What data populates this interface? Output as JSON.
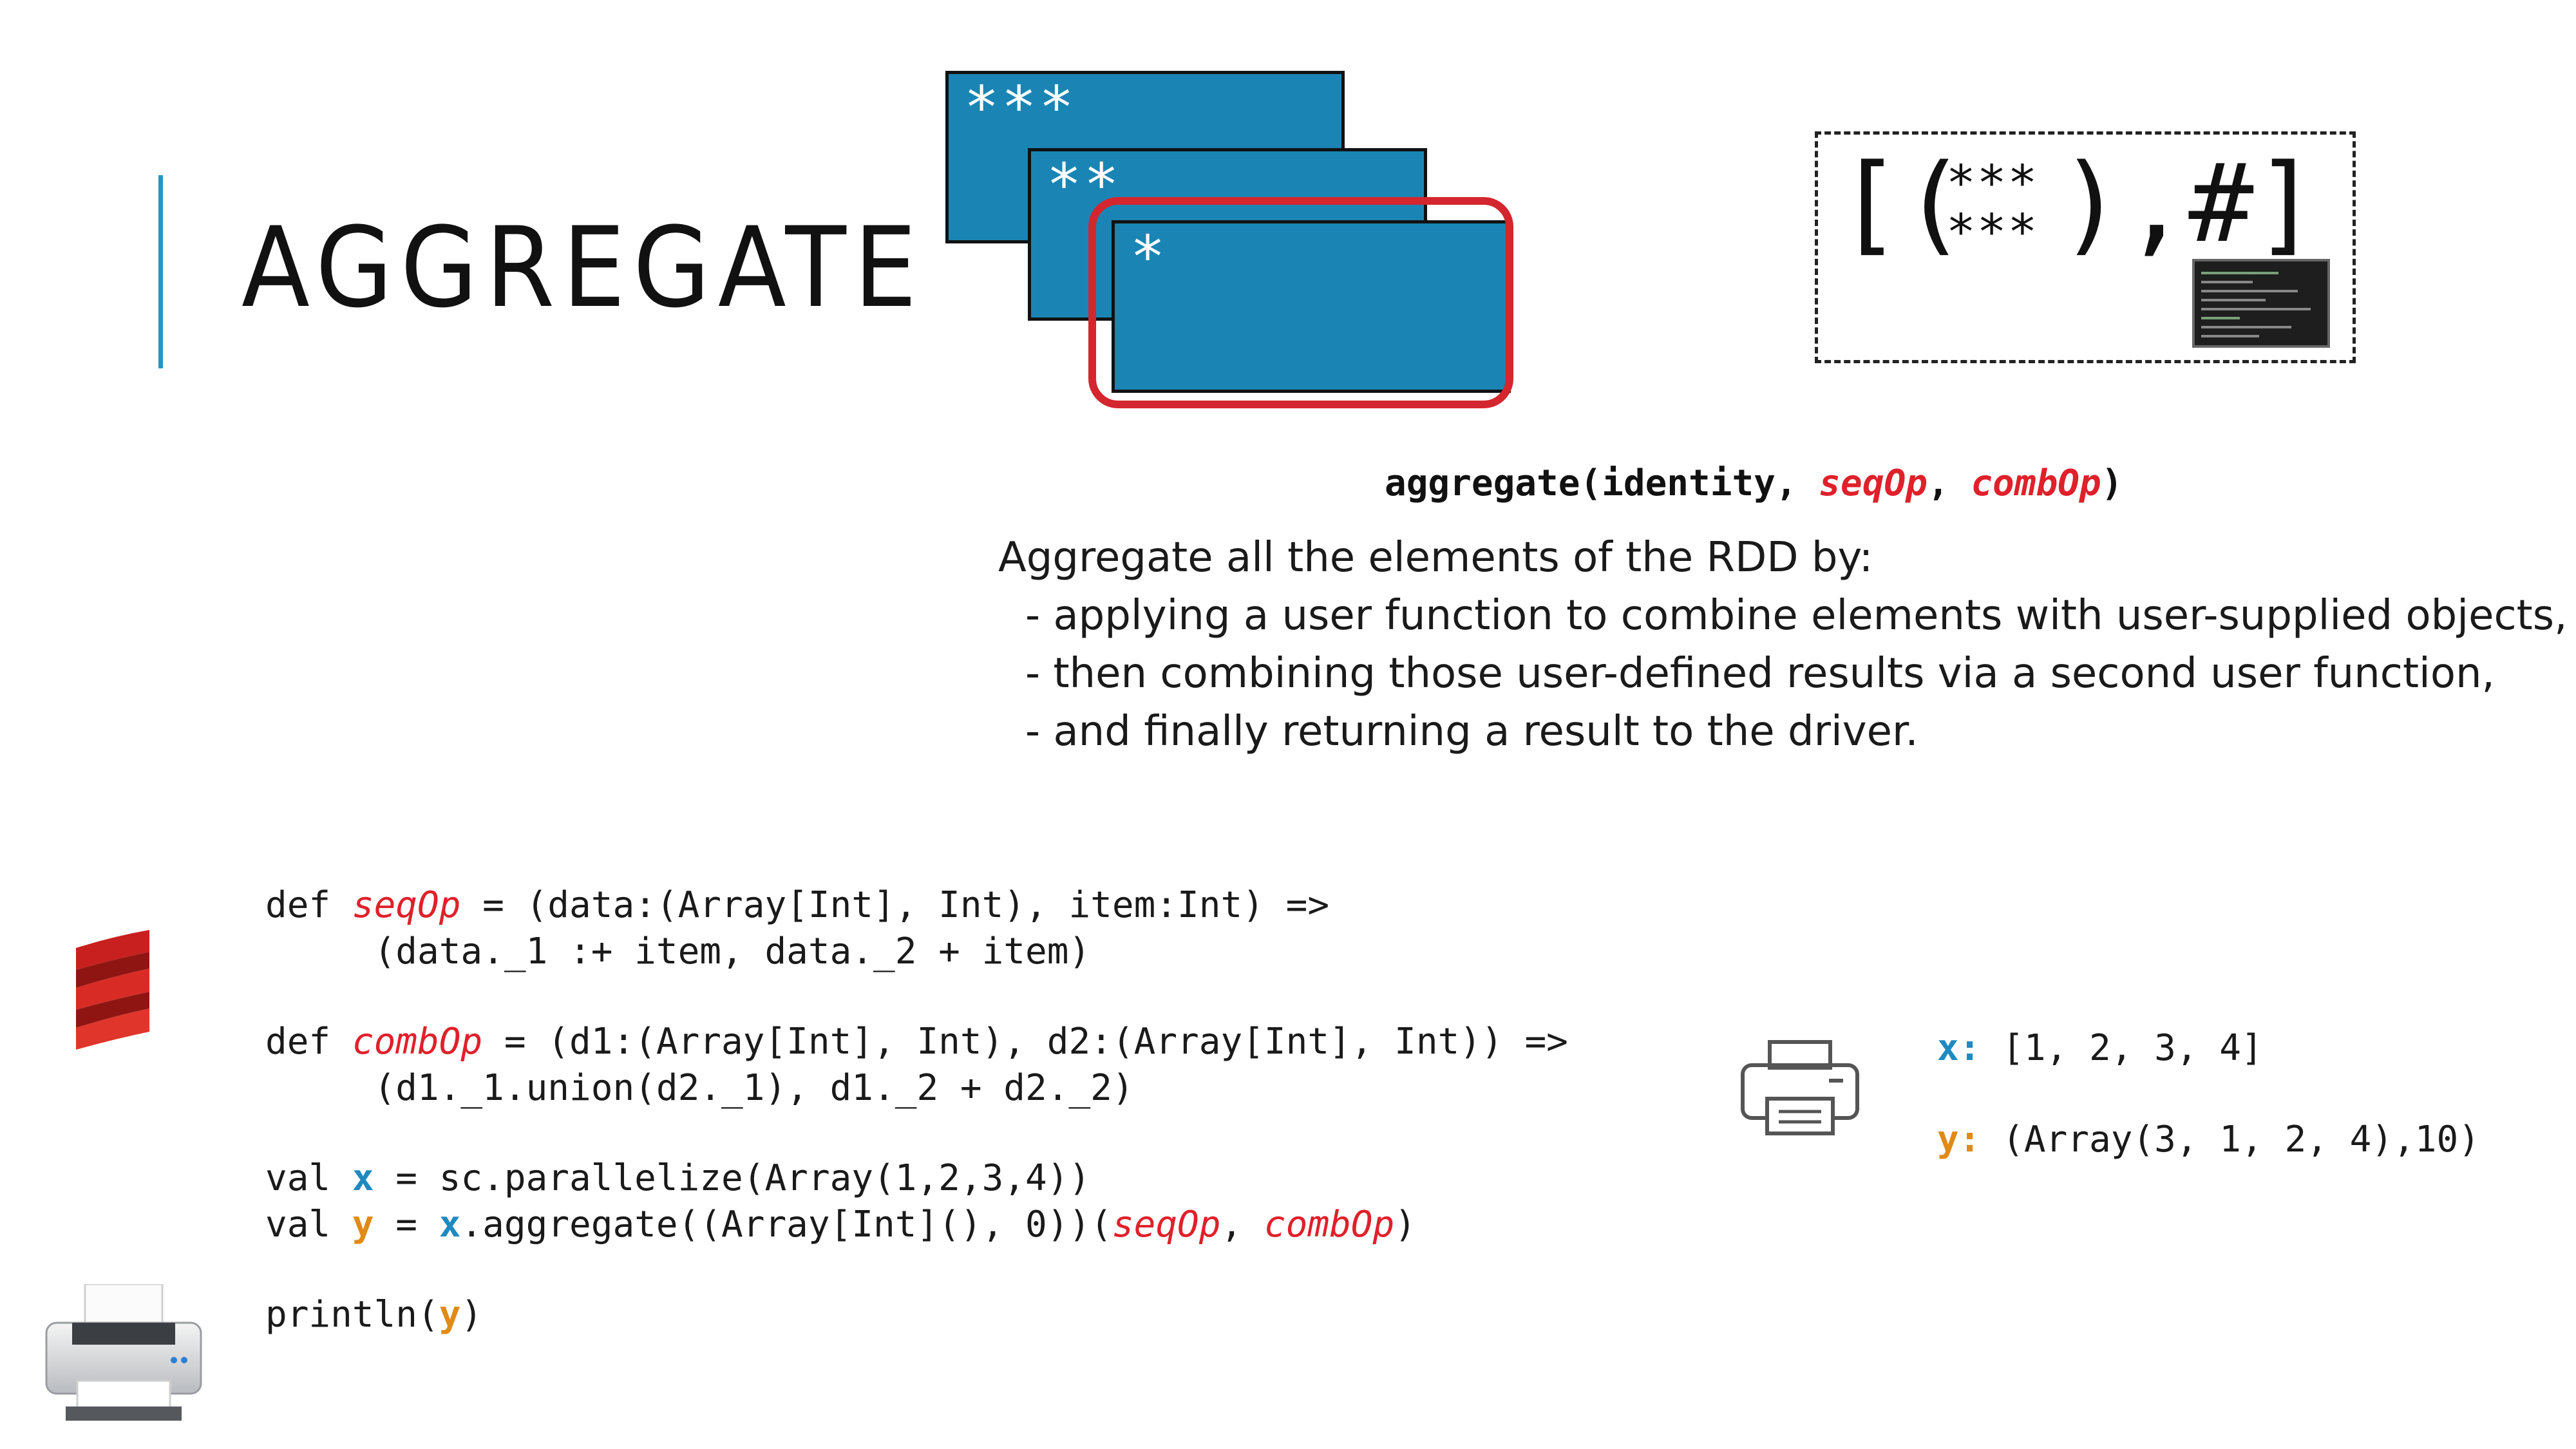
{
  "slide": {
    "title": "AGGREGATE"
  },
  "partitions": {
    "labels": [
      "***",
      "**",
      "*"
    ]
  },
  "result": {
    "open": "[(",
    "stars_top": "***",
    "stars_bottom": "***",
    "close": "),#]"
  },
  "signature": {
    "prefix": "aggregate(identity, ",
    "seq": "seqOp",
    "sep": ", ",
    "comb": "combOp",
    "suffix": ")"
  },
  "description": {
    "intro": "Aggregate all the elements of the RDD by:",
    "bullets": [
      "- applying a user function to combine elements with user-supplied objects,",
      "- then combining those user-defined results via a second user function,",
      "- and finally returning a result to the driver."
    ]
  },
  "code": {
    "l1_a": "def ",
    "l1_b": "seqOp",
    "l1_c": " = (data:(Array[Int], Int), item:Int) =>",
    "l2": "     (data._1 :+ item, data._2 + item)",
    "l3_a": "def ",
    "l3_b": "combOp",
    "l3_c": " = (d1:(Array[Int], Int), d2:(Array[Int], Int)) =>",
    "l4": "     (d1._1.union(d2._1), d1._2 + d2._2)",
    "l5_a": "val ",
    "l5_b": "x",
    "l5_c": " = sc.parallelize(Array(1,2,3,4))",
    "l6_a": "val ",
    "l6_b": "y",
    "l6_c": " = ",
    "l6_d": "x",
    "l6_e": ".aggregate((Array[Int](), 0))(",
    "l6_f": "seqOp",
    "l6_g": ", ",
    "l6_h": "combOp",
    "l6_i": ")",
    "l7_a": "println(",
    "l7_b": "y",
    "l7_c": ")"
  },
  "output": {
    "x_label": "x:",
    "x_value": " [1, 2, 3, 4]",
    "y_label": "y:",
    "y_value": " (Array(3, 1, 2, 4),10)"
  },
  "colors": {
    "accent_blue": "#2596c4",
    "partition_blue": "#1a85b4",
    "highlight_red": "#d4262e",
    "var_orange": "#e08a17"
  },
  "icons": [
    "scala-logo-icon",
    "printer-outline-icon",
    "printer-icon",
    "terminal-thumbnail-icon"
  ]
}
